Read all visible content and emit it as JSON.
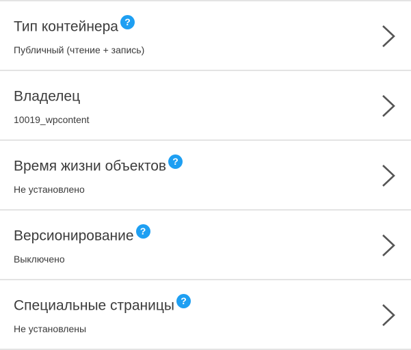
{
  "settings": {
    "items": [
      {
        "title": "Тип контейнера",
        "value": "Публичный (чтение + запись)",
        "help_icon": "?",
        "has_help": true
      },
      {
        "title": "Владелец",
        "value": "10019_wpcontent",
        "has_help": false
      },
      {
        "title": "Время жизни объектов",
        "value": "Не установлено",
        "help_icon": "?",
        "has_help": true
      },
      {
        "title": "Версионирование",
        "value": "Выключено",
        "help_icon": "?",
        "has_help": true
      },
      {
        "title": "Специальные страницы",
        "value": "Не установлены",
        "help_icon": "?",
        "has_help": true
      }
    ]
  },
  "colors": {
    "help_icon": "#1e9ff2",
    "divider": "#e3e3e3",
    "chevron": "#555555"
  },
  "icons": {
    "help": "question-circle-icon",
    "chevron": "chevron-right-icon"
  }
}
